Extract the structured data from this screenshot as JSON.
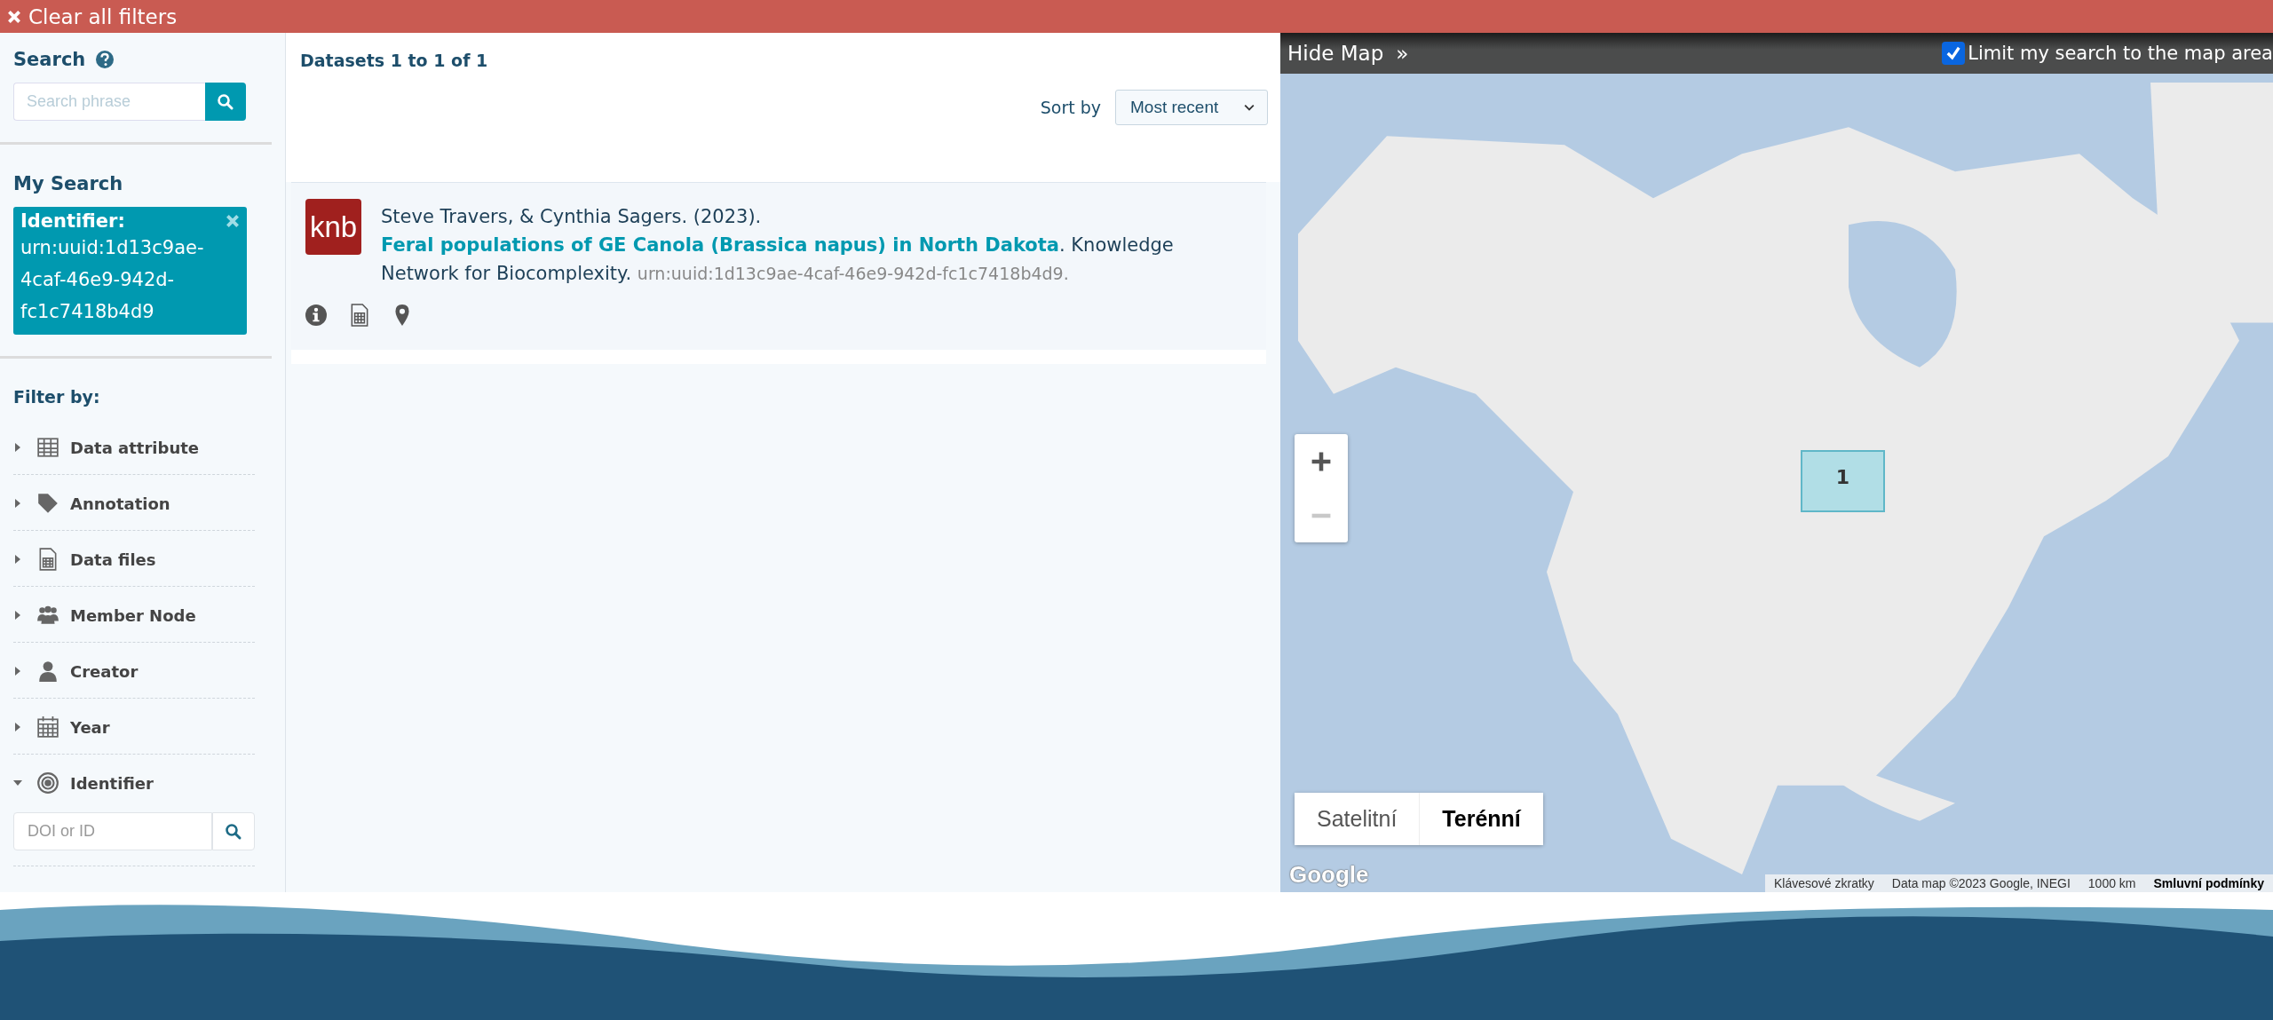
{
  "top_bar": {
    "clear_filters": "Clear all filters"
  },
  "sidebar": {
    "search": {
      "title": "Search",
      "placeholder": "Search phrase"
    },
    "my_search": {
      "title": "My Search",
      "filters": [
        {
          "label": "Identifier:",
          "value": "urn:uuid:1d13c9ae-4caf-46e9-942d-fc1c7418b4d9"
        }
      ]
    },
    "filter_by": {
      "title": "Filter by:",
      "sections": [
        {
          "kind": "table",
          "label": "Data attribute",
          "expanded": false
        },
        {
          "kind": "tag",
          "label": "Annotation",
          "expanded": false
        },
        {
          "kind": "file",
          "label": "Data files",
          "expanded": false
        },
        {
          "kind": "group",
          "label": "Member Node",
          "expanded": false
        },
        {
          "kind": "person",
          "label": "Creator",
          "expanded": false
        },
        {
          "kind": "calendar",
          "label": "Year",
          "expanded": false
        },
        {
          "kind": "target",
          "label": "Identifier",
          "expanded": true,
          "placeholder": "DOI or ID"
        }
      ]
    }
  },
  "results": {
    "count": "Datasets 1 to 1 of 1",
    "sort": {
      "label": "Sort by",
      "value": "Most recent"
    },
    "items": [
      {
        "badge": "knb",
        "authors": "Steve Travers, & Cynthia Sagers. (2023). ",
        "title": "Feral populations of GE Canola (Brassica napus) in North Dakota",
        "publisher": ". Knowledge Network for Biocomplexity. ",
        "id": "urn:uuid:1d13c9ae-4caf-46e9-942d-fc1c7418b4d9."
      }
    ]
  },
  "map": {
    "hide": "Hide Map",
    "hide_icon": "»",
    "limit": {
      "label": "Limit my search to the map area",
      "checked": true
    },
    "cluster": "1",
    "types": [
      {
        "label": "Satelitní",
        "selected": false
      },
      {
        "label": "Terénní",
        "selected": true
      }
    ],
    "logo": "Google",
    "attribution": [
      "Klávesové zkratky",
      "Data map ©2023 Google, INEGI",
      "1000 km",
      "Smluvní podmínky"
    ]
  }
}
